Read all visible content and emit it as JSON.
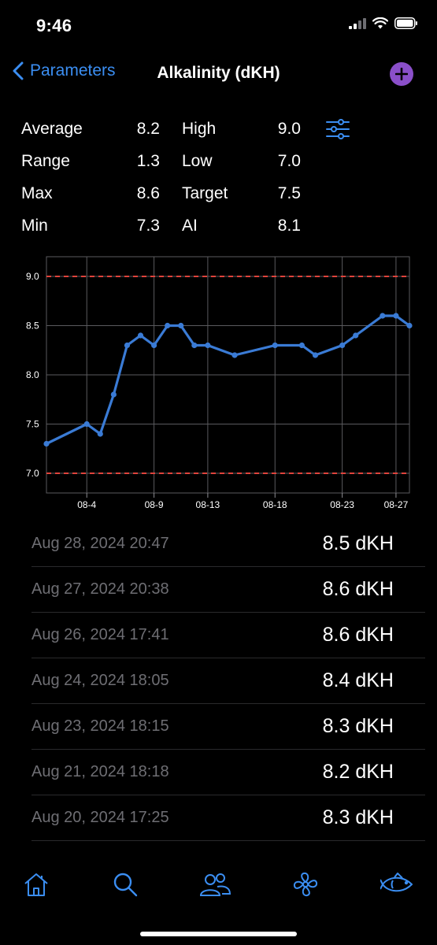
{
  "status_bar": {
    "time": "9:46"
  },
  "nav": {
    "back_label": "Parameters",
    "title": "Alkalinity (dKH)"
  },
  "stats": {
    "average_label": "Average",
    "average_value": "8.2",
    "range_label": "Range",
    "range_value": "1.3",
    "max_label": "Max",
    "max_value": "8.6",
    "min_label": "Min",
    "min_value": "7.3",
    "high_label": "High",
    "high_value": "9.0",
    "low_label": "Low",
    "low_value": "7.0",
    "target_label": "Target",
    "target_value": "7.5",
    "ai_label": "AI",
    "ai_value": "8.1"
  },
  "colors": {
    "accent": "#3b8ef2",
    "line": "#3a7bd5",
    "threshold": "#e0433b",
    "add": "#8a4fc9"
  },
  "chart_data": {
    "type": "line",
    "title": "",
    "xlabel": "",
    "ylabel": "",
    "ylim": [
      6.8,
      9.2
    ],
    "x_range_days": [
      1,
      28
    ],
    "yticks": [
      "7.0",
      "7.5",
      "8.0",
      "8.5",
      "9.0"
    ],
    "xticks": [
      {
        "day": 4,
        "label": "08-4"
      },
      {
        "day": 9,
        "label": "08-9"
      },
      {
        "day": 13,
        "label": "08-13"
      },
      {
        "day": 18,
        "label": "08-18"
      },
      {
        "day": 23,
        "label": "08-23"
      },
      {
        "day": 27,
        "label": "08-27"
      }
    ],
    "thresholds": [
      9.0,
      7.0
    ],
    "grid": true,
    "series": [
      {
        "x": [
          "08-01",
          "08-04",
          "08-05",
          "08-06",
          "08-07",
          "08-08",
          "08-09",
          "08-10",
          "08-11",
          "08-12",
          "08-13",
          "08-15",
          "08-18",
          "08-20",
          "08-21",
          "08-23",
          "08-24",
          "08-26",
          "08-27",
          "08-28"
        ],
        "day": [
          1,
          4,
          5,
          6,
          7,
          8,
          9,
          10,
          11,
          12,
          13,
          15,
          18,
          20,
          21,
          23,
          24,
          26,
          27,
          28
        ],
        "values": [
          7.3,
          7.5,
          7.4,
          7.8,
          8.3,
          8.4,
          8.3,
          8.5,
          8.5,
          8.3,
          8.3,
          8.2,
          8.3,
          8.3,
          8.2,
          8.3,
          8.4,
          8.6,
          8.6,
          8.5
        ]
      }
    ]
  },
  "readings": [
    {
      "date": "Aug 28, 2024 20:47",
      "value": "8.5 dKH"
    },
    {
      "date": "Aug 27, 2024 20:38",
      "value": "8.6 dKH"
    },
    {
      "date": "Aug 26, 2024 17:41",
      "value": "8.6 dKH"
    },
    {
      "date": "Aug 24, 2024 18:05",
      "value": "8.4 dKH"
    },
    {
      "date": "Aug 23, 2024 18:15",
      "value": "8.3 dKH"
    },
    {
      "date": "Aug 21, 2024 18:18",
      "value": "8.2 dKH"
    },
    {
      "date": "Aug 20, 2024 17:25",
      "value": "8.3 dKH"
    }
  ],
  "tabs": [
    {
      "name": "home",
      "icon": "home-icon"
    },
    {
      "name": "search",
      "icon": "search-icon"
    },
    {
      "name": "people",
      "icon": "people-icon"
    },
    {
      "name": "fan",
      "icon": "fan-icon"
    },
    {
      "name": "fish",
      "icon": "fish-icon"
    }
  ]
}
